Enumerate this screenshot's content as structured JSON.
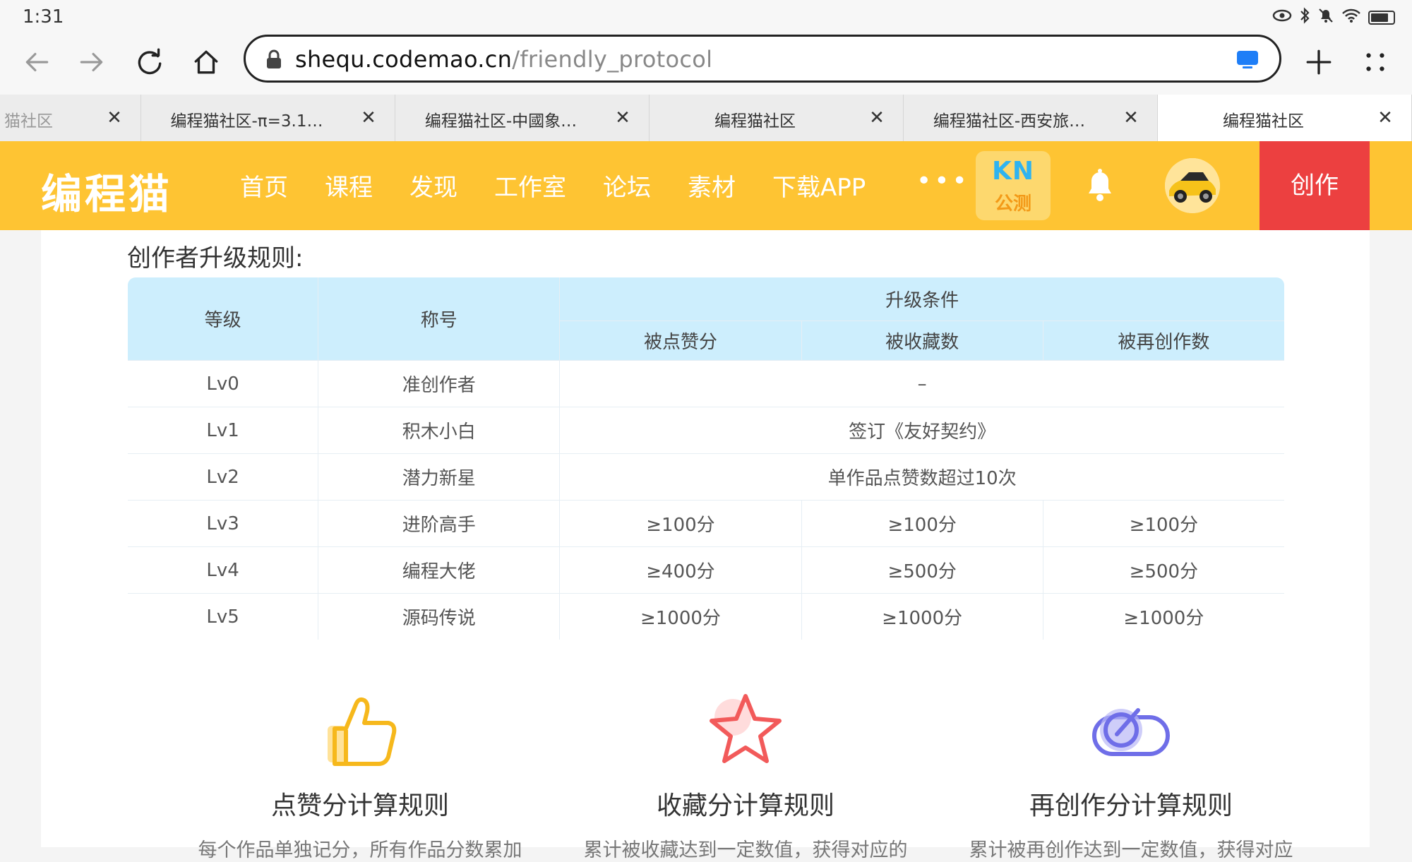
{
  "status_bar": {
    "time": "1:31"
  },
  "browser": {
    "url_host": "shequ.codemao.cn",
    "url_path": "/friendly_protocol",
    "tabs": [
      {
        "title": "猫社区"
      },
      {
        "title": "编程猫社区-π=3.1…"
      },
      {
        "title": "编程猫社区-中國象…"
      },
      {
        "title": "编程猫社区"
      },
      {
        "title": "编程猫社区-西安旅…"
      },
      {
        "title": "编程猫社区"
      }
    ]
  },
  "site_header": {
    "logo": "编程猫",
    "nav": [
      "首页",
      "课程",
      "发现",
      "工作室",
      "论坛",
      "素材",
      "下载APP"
    ],
    "more": "•••",
    "kn_top": "KN",
    "kn_bottom": "公测",
    "create_label": "创作"
  },
  "content": {
    "section_title": "创作者升级规则:",
    "table": {
      "headers": {
        "level": "等级",
        "title": "称号",
        "conditions": "升级条件",
        "likes": "被点赞分",
        "favorites": "被收藏数",
        "remixes": "被再创作数"
      },
      "rows": [
        {
          "level": "Lv0",
          "title": "准创作者",
          "merged": "–"
        },
        {
          "level": "Lv1",
          "title": "积木小白",
          "merged": "签订《友好契约》"
        },
        {
          "level": "Lv2",
          "title": "潜力新星",
          "merged": "单作品点赞数超过10次"
        },
        {
          "level": "Lv3",
          "title": "进阶高手",
          "likes": "≥100分",
          "favorites": "≥100分",
          "remixes": "≥100分"
        },
        {
          "level": "Lv4",
          "title": "编程大佬",
          "likes": "≥400分",
          "favorites": "≥500分",
          "remixes": "≥500分"
        },
        {
          "level": "Lv5",
          "title": "源码传说",
          "likes": "≥1000分",
          "favorites": "≥1000分",
          "remixes": "≥1000分"
        }
      ]
    },
    "features": [
      {
        "title": "点赞分计算规则",
        "desc": "每个作品单独记分，所有作品分数累加"
      },
      {
        "title": "收藏分计算规则",
        "desc": "累计被收藏达到一定数值，获得对应的"
      },
      {
        "title": "再创作分计算规则",
        "desc": "累计被再创作达到一定数值，获得对应"
      }
    ]
  },
  "colors": {
    "header_bg": "#fec433",
    "create_bg": "#ec4040",
    "table_header_bg": "#cdeefd",
    "kn_blue": "#2fb3f0"
  }
}
